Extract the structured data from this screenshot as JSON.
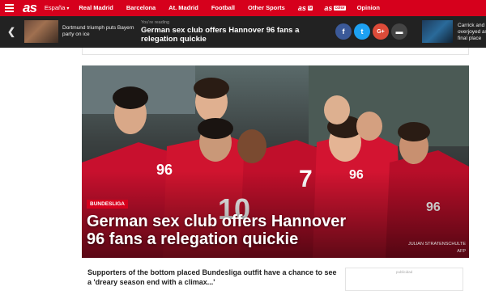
{
  "nav": {
    "logo": "as",
    "items": [
      {
        "label": "España",
        "caret": "▾"
      },
      {
        "label": "Real Madrid"
      },
      {
        "label": "Barcelona"
      },
      {
        "label": "At. Madrid"
      },
      {
        "label": "Football"
      },
      {
        "label": "Other Sports"
      }
    ],
    "brand_tv": "as",
    "brand_tv_sub": "tv",
    "brand_color": "as",
    "brand_color_sub": "color",
    "opinion": "Opinion"
  },
  "sharebar": {
    "prev_article": "Dortmund triumph puts Bayern party on ice",
    "reading_label": "You're reading",
    "reading_title": "German sex club offers Hannover 96 fans a relegation quickie",
    "next_article": "Carrick and overjoyed as final place",
    "social": [
      {
        "icon": "facebook-icon",
        "glyph": "f"
      },
      {
        "icon": "twitter-icon",
        "glyph": "t"
      },
      {
        "icon": "googleplus-icon",
        "glyph": "G+"
      },
      {
        "icon": "comment-icon",
        "glyph": "▬"
      }
    ]
  },
  "hero": {
    "category": "BUNDESLIGA",
    "title": "German sex club offers Hannover 96 fans a relegation quickie",
    "credit_name": "JULIAN STRATENSCHULTE",
    "credit_agency": "AFP"
  },
  "lead": "Supporters of the bottom placed Bundesliga outfit have a chance to see a 'dreary season end with a climax...'",
  "adbox": {
    "label": "publicidad"
  },
  "colors": {
    "brand_red": "#d6001c",
    "sharebar_bg": "#222222"
  }
}
